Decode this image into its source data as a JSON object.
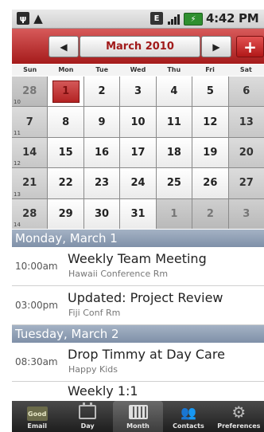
{
  "status_bar": {
    "usb_icon": "usb-icon",
    "warning_icon": "warning-icon",
    "exchange_icon": "exchange-icon",
    "signal_icon": "signal-icon",
    "battery_icon": "battery-charging-icon",
    "time": "4:42 PM"
  },
  "header": {
    "month": "March 2010",
    "prev_symbol": "◀",
    "next_symbol": "▶",
    "add_symbol": "+"
  },
  "weekdays": [
    "Sun",
    "Mon",
    "Tue",
    "Wed",
    "Thu",
    "Fri",
    "Sat"
  ],
  "weeks": [
    {
      "week": "10",
      "days": [
        "28",
        "1",
        "2",
        "3",
        "4",
        "5",
        "6"
      ]
    },
    {
      "week": "11",
      "days": [
        "7",
        "8",
        "9",
        "10",
        "11",
        "12",
        "13"
      ]
    },
    {
      "week": "12",
      "days": [
        "14",
        "15",
        "16",
        "17",
        "18",
        "19",
        "20"
      ]
    },
    {
      "week": "13",
      "days": [
        "21",
        "22",
        "23",
        "24",
        "25",
        "26",
        "27"
      ]
    },
    {
      "week": "14",
      "days": [
        "28",
        "29",
        "30",
        "31",
        "1",
        "2",
        "3"
      ]
    }
  ],
  "agenda": {
    "day1": {
      "heading": "Monday, March 1",
      "events": [
        {
          "time": "10:00am",
          "title": "Weekly Team Meeting",
          "location": "Hawaii Conference Rm"
        },
        {
          "time": "03:00pm",
          "title": "Updated: Project Review",
          "location": "Fiji Conf Rm"
        }
      ]
    },
    "day2": {
      "heading": "Tuesday, March 2",
      "events": [
        {
          "time": "08:30am",
          "title": "Drop Timmy at Day Care",
          "location": "Happy Kids"
        },
        {
          "time": "",
          "title": "Weekly 1:1",
          "location": ""
        }
      ]
    }
  },
  "tabs": [
    {
      "label": "Email",
      "icon": "good-email-icon",
      "icon_text": "Good"
    },
    {
      "label": "Day",
      "icon": "day-calendar-icon"
    },
    {
      "label": "Month",
      "icon": "month-calendar-icon"
    },
    {
      "label": "Contacts",
      "icon": "contacts-icon",
      "icon_text": "👥"
    },
    {
      "label": "Preferences",
      "icon": "gear-icon",
      "icon_text": "⚙"
    }
  ],
  "active_tab": "Month",
  "selected_date": "1",
  "colors": {
    "accent_red": "#b32323",
    "day_header_blue": "#8f9fb6",
    "tabbar": "#2a2a2a"
  }
}
